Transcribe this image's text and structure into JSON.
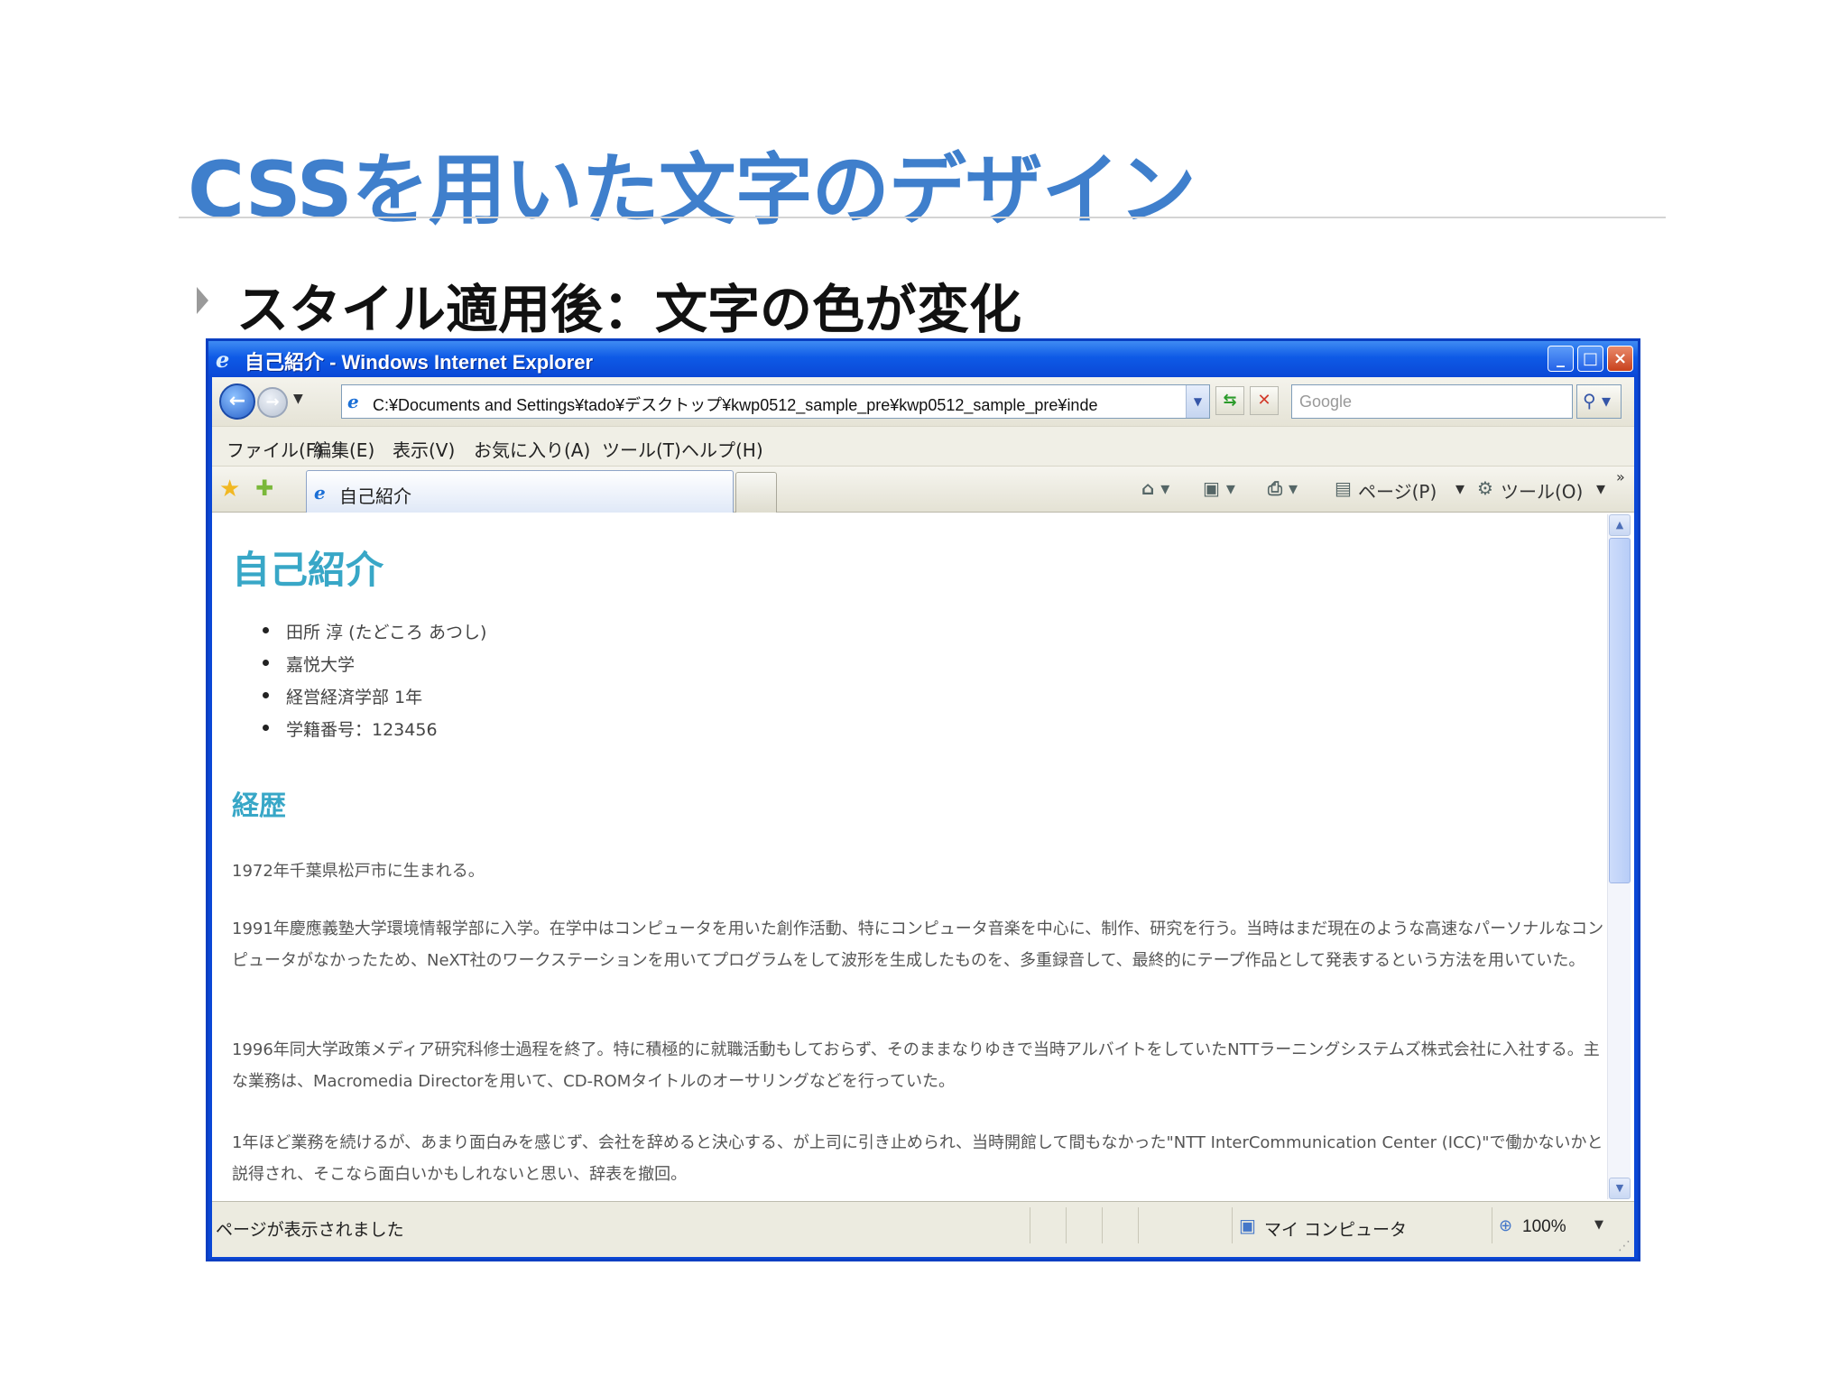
{
  "slide": {
    "title": "CSSを用いた文字のデザイン",
    "bullet": "スタイル適用後：文字の色が変化"
  },
  "window": {
    "title": "自己紹介 - Windows Internet Explorer",
    "address": "C:¥Documents and Settings¥tado¥デスクトップ¥kwp0512_sample_pre¥kwp0512_sample_pre¥inde",
    "search_placeholder": "Google",
    "menu": [
      "ファイル(F)",
      "編集(E)",
      "表示(V)",
      "お気に入り(A)",
      "ツール(T)",
      "ヘルプ(H)"
    ],
    "tab_label": "自己紹介",
    "commands": {
      "page": "ページ(P)",
      "tools": "ツール(O)"
    }
  },
  "document": {
    "heading": "自己紹介",
    "list": [
      "田所 淳 (たどころ あつし)",
      "嘉悦大学",
      "経営経済学部 1年",
      "学籍番号：123456"
    ],
    "subheading": "経歴",
    "paragraphs": [
      "1972年千葉県松戸市に生まれる。",
      "1991年慶應義塾大学環境情報学部に入学。在学中はコンピュータを用いた創作活動、特にコンピュータ音楽を中心に、制作、研究を行う。当時はまだ現在のような高速なパーソナルなコンピュータがなかったため、NeXT社のワークステーションを用いてプログラムをして波形を生成したものを、多重録音して、最終的にテープ作品として発表するという方法を用いていた。",
      "1996年同大学政策メディア研究科修士過程を終了。特に積極的に就職活動もしておらず、そのままなりゆきで当時アルバイトをしていたNTTラーニングシステムズ株式会社に入社する。主な業務は、Macromedia Directorを用いて、CD-ROMタイトルのオーサリングなどを行っていた。",
      "1年ほど業務を続けるが、あまり面白みを感じず、会社を辞めると決心する、が上司に引き止められ、当時開館して間もなかった\"NTT InterCommunication Center (ICC)\"で働かないかと説得され、そこなら面白いかもしれないと思い、辞表を撤回。"
    ]
  },
  "status": {
    "text": "ページが表示されました",
    "zone": "マイ コンピュータ",
    "zoom": "100%"
  },
  "colors": {
    "slide_title": "#3f7fcc",
    "doc_heading": "#38a7c7",
    "window_frame": "#0a47d6"
  },
  "icons": [
    "ie-icon",
    "back-arrow-icon",
    "forward-arrow-icon",
    "refresh-icon",
    "stop-icon",
    "search-icon",
    "favorites-star-icon",
    "add-favorite-icon",
    "home-icon",
    "feeds-icon",
    "print-icon",
    "page-icon",
    "tools-gear-icon",
    "computer-icon",
    "zoom-icon"
  ]
}
